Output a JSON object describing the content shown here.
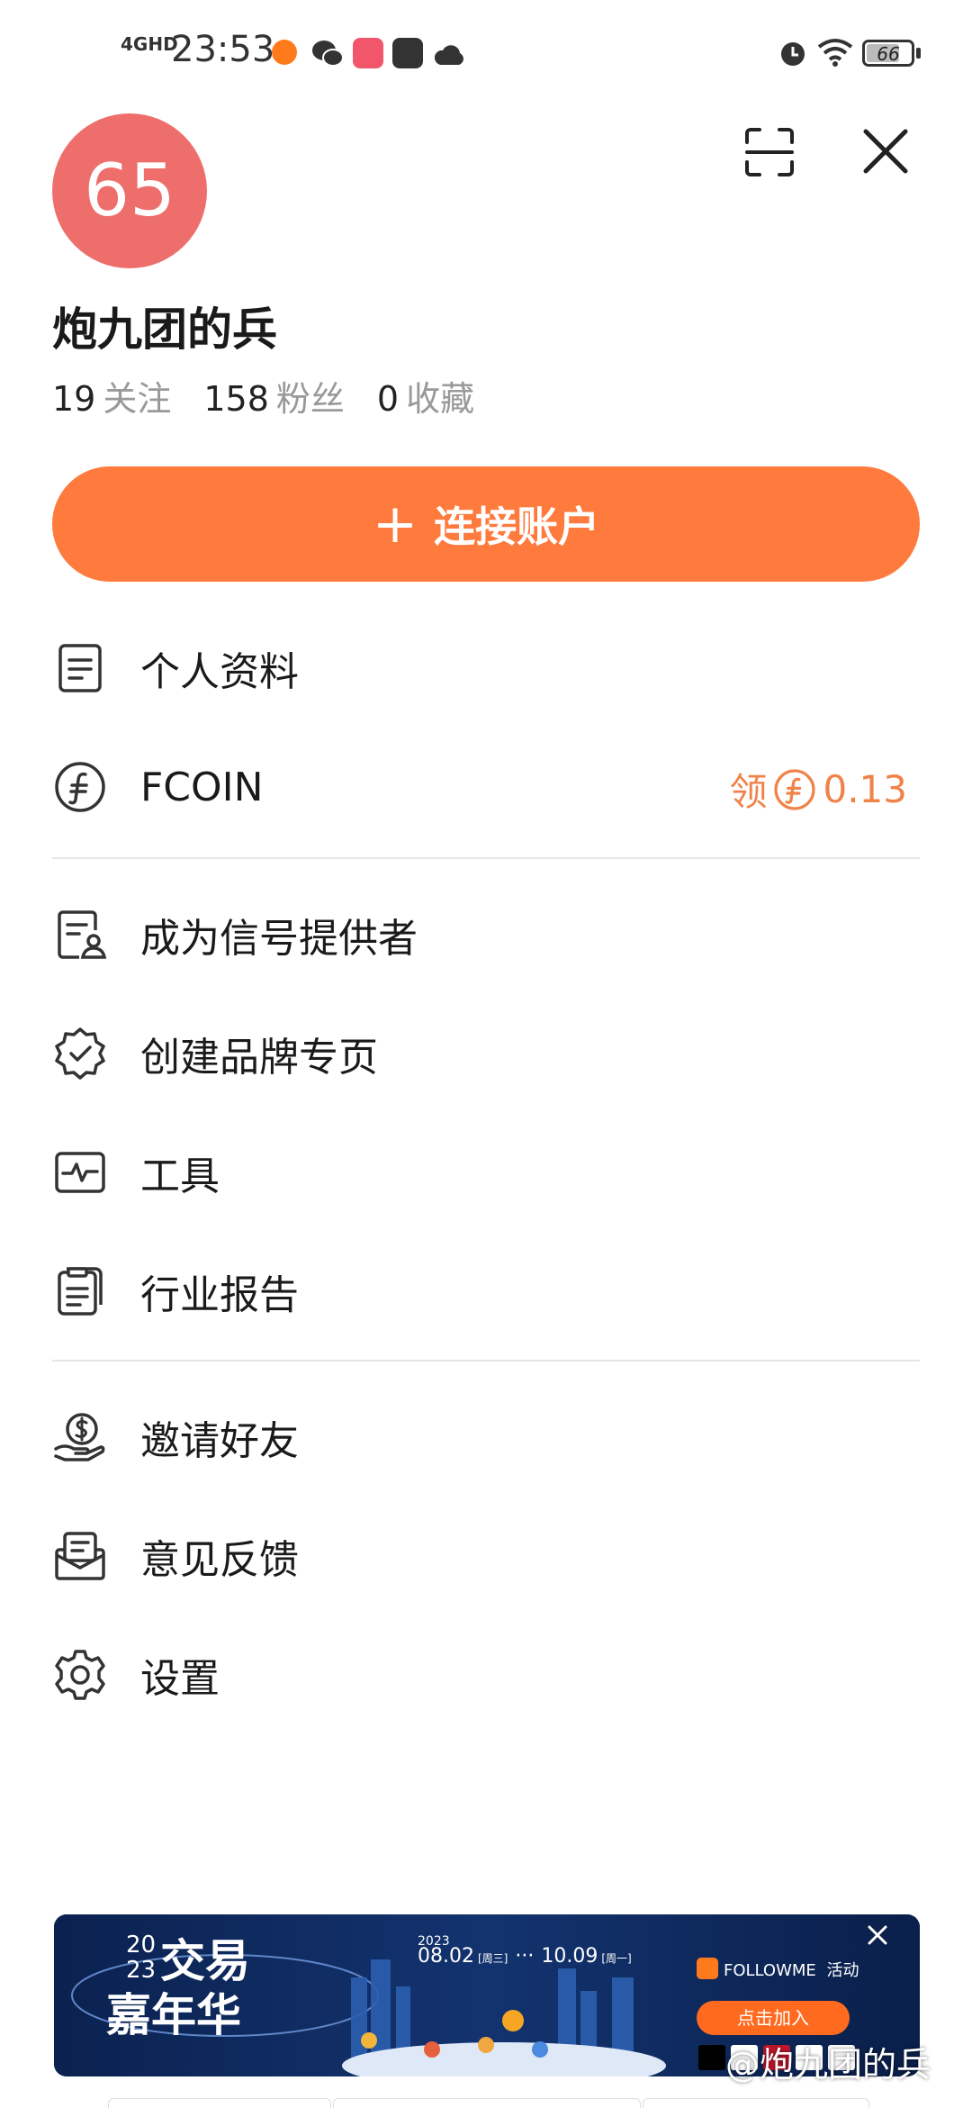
{
  "status_bar": {
    "network": "4GHD",
    "time": "23:53",
    "battery": "66"
  },
  "profile": {
    "avatar_text": "65",
    "name": "炮九团的兵",
    "stats": [
      {
        "num": "19",
        "label": "关注"
      },
      {
        "num": "158",
        "label": "粉丝"
      },
      {
        "num": "0",
        "label": "收藏"
      }
    ]
  },
  "connect_button": {
    "label": "连接账户"
  },
  "menu": {
    "profile": "个人资料",
    "fcoin": "FCOIN",
    "fcoin_reward_prefix": "领",
    "fcoin_reward_value": "0.13",
    "signal_provider": "成为信号提供者",
    "brand_page": "创建品牌专页",
    "tools": "工具",
    "industry_report": "行业报告",
    "invite_friends": "邀请好友",
    "feedback": "意见反馈",
    "settings": "设置"
  },
  "banner": {
    "year_top": "20",
    "year_bottom": "23",
    "title_line1": "交易",
    "title_line2": "嘉年华",
    "date_year": "2023",
    "date_start": "08.02",
    "date_start_day": "[周三]",
    "date_end": "10.09",
    "date_end_day": "[周一]",
    "brand": "FOLLOWME",
    "brand_suffix": "活动",
    "join_button": "点击加入"
  },
  "watermark": "@炮九团的兵",
  "colors": {
    "accent": "#ff7a3d",
    "avatar": "#ee6e6b",
    "reward": "#f0834a",
    "banner_bg": "#0e2554"
  }
}
